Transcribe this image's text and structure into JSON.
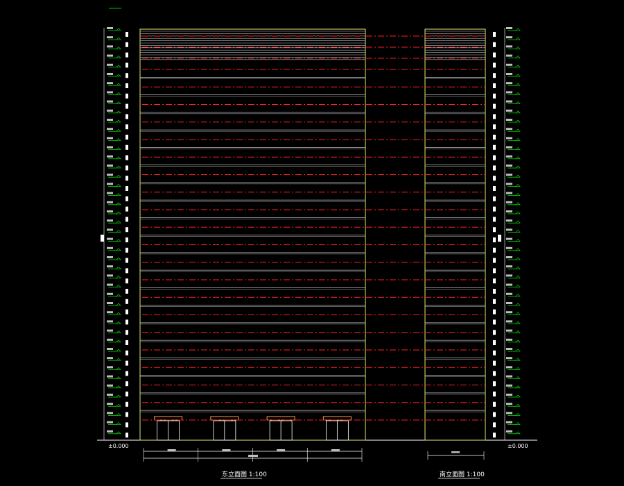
{
  "drawing": {
    "east_title": "东立面图 1:100",
    "south_title": "南立面图 1:100",
    "colors": {
      "background": "#000000",
      "red_dash": "#ff2020",
      "yellow": "#e8e870",
      "green": "#00ff00",
      "white": "#ffffff",
      "gray": "#b8b8b8",
      "orange": "#ff9a40"
    },
    "floor_count": 20,
    "east_bay_count": 4,
    "ground_level_label": "±0.000"
  }
}
